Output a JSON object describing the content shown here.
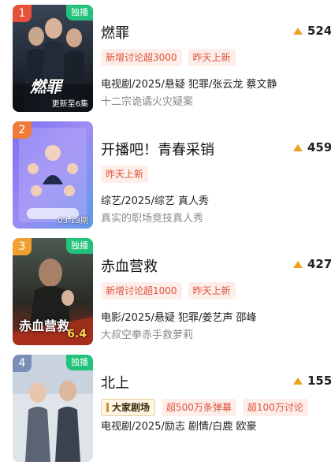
{
  "items": [
    {
      "rank": "1",
      "rank_color": "#e8503a",
      "exclusive": "独播",
      "title": "燃罪",
      "heat": "524",
      "tags": [
        "新增讨论超3000",
        "昨天上新"
      ],
      "meta": "电视剧/2025/悬疑 犯罪/张云龙 蔡文静",
      "desc": "十二宗诡谲火灾疑案",
      "episode": "更新至6集",
      "poster_text": "燃罪"
    },
    {
      "rank": "2",
      "rank_color": "#f07a3a",
      "title": "开播吧！青春采销",
      "heat": "459",
      "tags": [
        "昨天上新"
      ],
      "meta": "综艺/2025/综艺 真人秀",
      "desc": "真实的职场竞技真人秀",
      "episode": "03 13期"
    },
    {
      "rank": "3",
      "rank_color": "#f0a030",
      "exclusive": "独播",
      "title": "赤血营救",
      "heat": "427",
      "tags": [
        "新增讨论超1000",
        "昨天上新"
      ],
      "meta": "电影/2025/悬疑 犯罪/姜艺声 邵峰",
      "desc": "大叔空拳赤手救萝莉",
      "poster_text": "赤血营救",
      "poster_date": "6.4"
    },
    {
      "rank": "4",
      "rank_color": "#7a8fb8",
      "exclusive": "独播",
      "title": "北上",
      "heat": "155",
      "brand": "大家剧场",
      "tags": [
        "超500万条弹幕",
        "超100万讨论"
      ],
      "meta": "电视剧/2025/励志 剧情/白鹿 欧豪"
    }
  ]
}
